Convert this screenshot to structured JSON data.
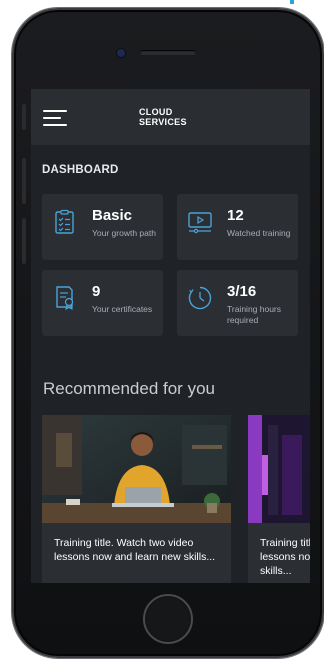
{
  "header": {
    "brand_line1": "CLOUD",
    "brand_line2": "SERVICES"
  },
  "dashboard": {
    "title": "DASHBOARD",
    "cards": [
      {
        "value": "Basic",
        "label": "Your growth path",
        "icon": "checklist-icon"
      },
      {
        "value": "12",
        "label": "Watched training",
        "icon": "video-player-icon"
      },
      {
        "value": "9",
        "label": "Your certificates",
        "icon": "certificate-icon"
      },
      {
        "value": "3/16",
        "label": "Training hours required",
        "icon": "clock-icon"
      }
    ]
  },
  "recommended": {
    "title": "Recommended for you",
    "items": [
      {
        "text": "Training title. Watch two video lessons now and learn new skills..."
      },
      {
        "text": "Training title. Watch two video lessons now and learn new skills..."
      }
    ]
  },
  "colors": {
    "screen_bg": "#1f2226",
    "card_bg": "#2b2f34",
    "accent": "#4aa3d8"
  }
}
